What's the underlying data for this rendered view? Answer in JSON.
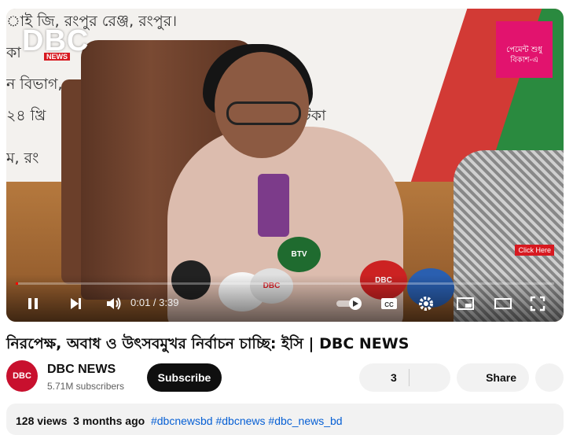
{
  "video": {
    "overlay_logo_main": "DBC",
    "overlay_logo_sub": "NEWS",
    "banner_lines": [
      "াই জি, রংপুর রেঞ্জ, রংপুর।",
      "কা",
      "ন বিভাগ,",
      "২৪ খ্রি",
      "ম, রং"
    ],
    "banner_right": "টিকা",
    "ad_text": "পেমেন্ট শুধু বিকাশ-এ",
    "click_here": "Click Here",
    "mic_labels": [
      "BTV",
      "DBC",
      "DBC"
    ],
    "time_current": "0:01",
    "time_separator": " / ",
    "time_total": "3:39",
    "progress_fraction": 0.004
  },
  "title": "নিরপেক্ষ, অবাধ ও উৎসবমুখর নির্বাচন চাচ্ছি: ইসি | DBC NEWS",
  "channel": {
    "avatar_text": "DBC",
    "name": "DBC NEWS",
    "subscribers": "5.71M subscribers",
    "subscribe_label": "Subscribe"
  },
  "actions": {
    "like_count": "3",
    "share_label": "Share"
  },
  "description": {
    "views": "128 views",
    "age": "3 months ago",
    "hashtags": "#dbcnewsbd #dbcnews #dbc_news_bd"
  },
  "icons": {
    "pause": "pause-icon",
    "next": "next-icon",
    "volume": "volume-icon",
    "autoplay": "autoplay-toggle-icon",
    "captions": "captions-icon",
    "settings": "gear-icon",
    "miniplayer": "miniplayer-icon",
    "theater": "theater-icon",
    "fullscreen": "fullscreen-icon",
    "like": "thumbs-up-icon",
    "dislike": "thumbs-down-icon",
    "share": "share-icon",
    "more": "more-icon"
  },
  "colors": {
    "subscribe_bg": "#0f0f0f",
    "progress": "#ff0000",
    "hashtag": "#065fd4"
  }
}
